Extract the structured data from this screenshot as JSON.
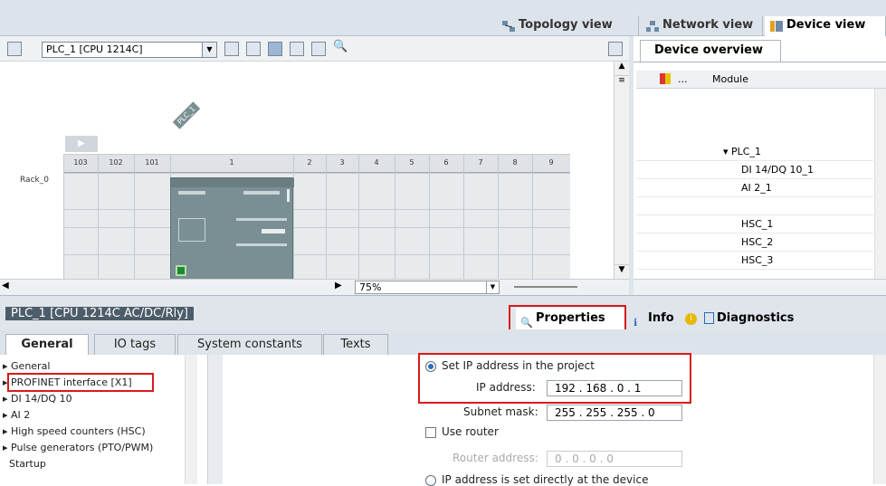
{
  "view_tabs": {
    "topology": "Topology view",
    "network": "Network view",
    "device": "Device view"
  },
  "toolbar": {
    "device_select": "PLC_1 [CPU 1214C]",
    "zoom": "75%"
  },
  "rack": {
    "plc_label": "PLC_1",
    "rack_label": "Rack_0",
    "slots": [
      "103",
      "102",
      "101",
      "1",
      "2",
      "3",
      "4",
      "5",
      "6",
      "7",
      "8",
      "9"
    ]
  },
  "device_overview": {
    "tab": "Device overview",
    "col_dots": "...",
    "col_module": "Module",
    "rows": [
      "PLC_1",
      "DI 14/DQ 10_1",
      "AI 2_1",
      "",
      "HSC_1",
      "HSC_2",
      "HSC_3"
    ]
  },
  "properties": {
    "title": "PLC_1 [CPU 1214C AC/DC/Rly]",
    "tabs": {
      "properties": "Properties",
      "info": "Info",
      "diagnostics": "Diagnostics"
    }
  },
  "subtabs": [
    "General",
    "IO tags",
    "System constants",
    "Texts"
  ],
  "nav_items": [
    "General",
    "PROFINET interface [X1]",
    "DI 14/DQ 10",
    "AI 2",
    "High speed counters (HSC)",
    "Pulse generators (PTO/PWM)",
    "Startup"
  ],
  "ip": {
    "set_in_project": "Set IP address in the project",
    "ip_label": "IP address:",
    "ip_value": "192 . 168 . 0    . 1",
    "subnet_label": "Subnet mask:",
    "subnet_value": "255 . 255 . 255 . 0",
    "use_router": "Use router",
    "router_label": "Router address:",
    "router_value": "0    . 0    . 0    . 0",
    "set_at_device": "IP address is set directly at the device"
  },
  "colors": {
    "highlight": "#d81b1b",
    "cpu": "#7a8f93"
  }
}
